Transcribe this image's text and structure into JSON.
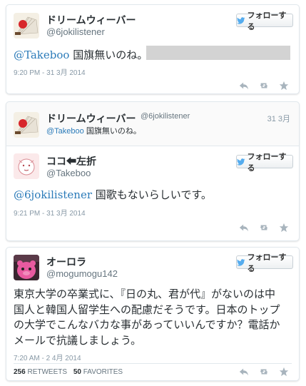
{
  "tweet1": {
    "name": "ドリームウィーバー",
    "handle": "@6jokilistener",
    "follow_label": "フォローする",
    "mention": "@Takeboo",
    "text": " 国旗無いのね。",
    "timestamp": "9:20 PM - 31 3月 2014"
  },
  "tweet2": {
    "parent_name": "ドリームウィーバー",
    "parent_handle": "@6jokilistener",
    "parent_date": "31 3月",
    "parent_mention": "@Takeboo",
    "parent_text": " 国旗無いのね。",
    "name": "ココ⬅左折",
    "handle": "@Takeboo",
    "follow_label": "フォローする",
    "mention": "@6jokilistener",
    "text": " 国歌もないらしいです。",
    "timestamp": "9:21 PM - 31 3月 2014"
  },
  "tweet3": {
    "name": "オーロラ",
    "handle": "@mogumogu142",
    "follow_label": "フォローする",
    "lines": [
      "東京大学の卒業式に、『日の丸、君が代』がないのは中",
      "国人と韓国人留学生への配慮だそうです。日本のトップ",
      "の大学でこんなバカな事があっていいんですか？電話か",
      "メールで抗議しましょう。"
    ],
    "timestamp": "7:20 AM - 2 4月 2014",
    "retweets_count": "256",
    "retweets_label": "RETWEETS",
    "favorites_count": "50",
    "favorites_label": "FAVORITES"
  },
  "icons": [
    "twitter-bird-icon",
    "reply-icon",
    "retweet-icon",
    "favorite-icon"
  ],
  "colors": {
    "accent": "#2b7bb9",
    "muted": "#8899a6",
    "bird": "#55acee"
  }
}
